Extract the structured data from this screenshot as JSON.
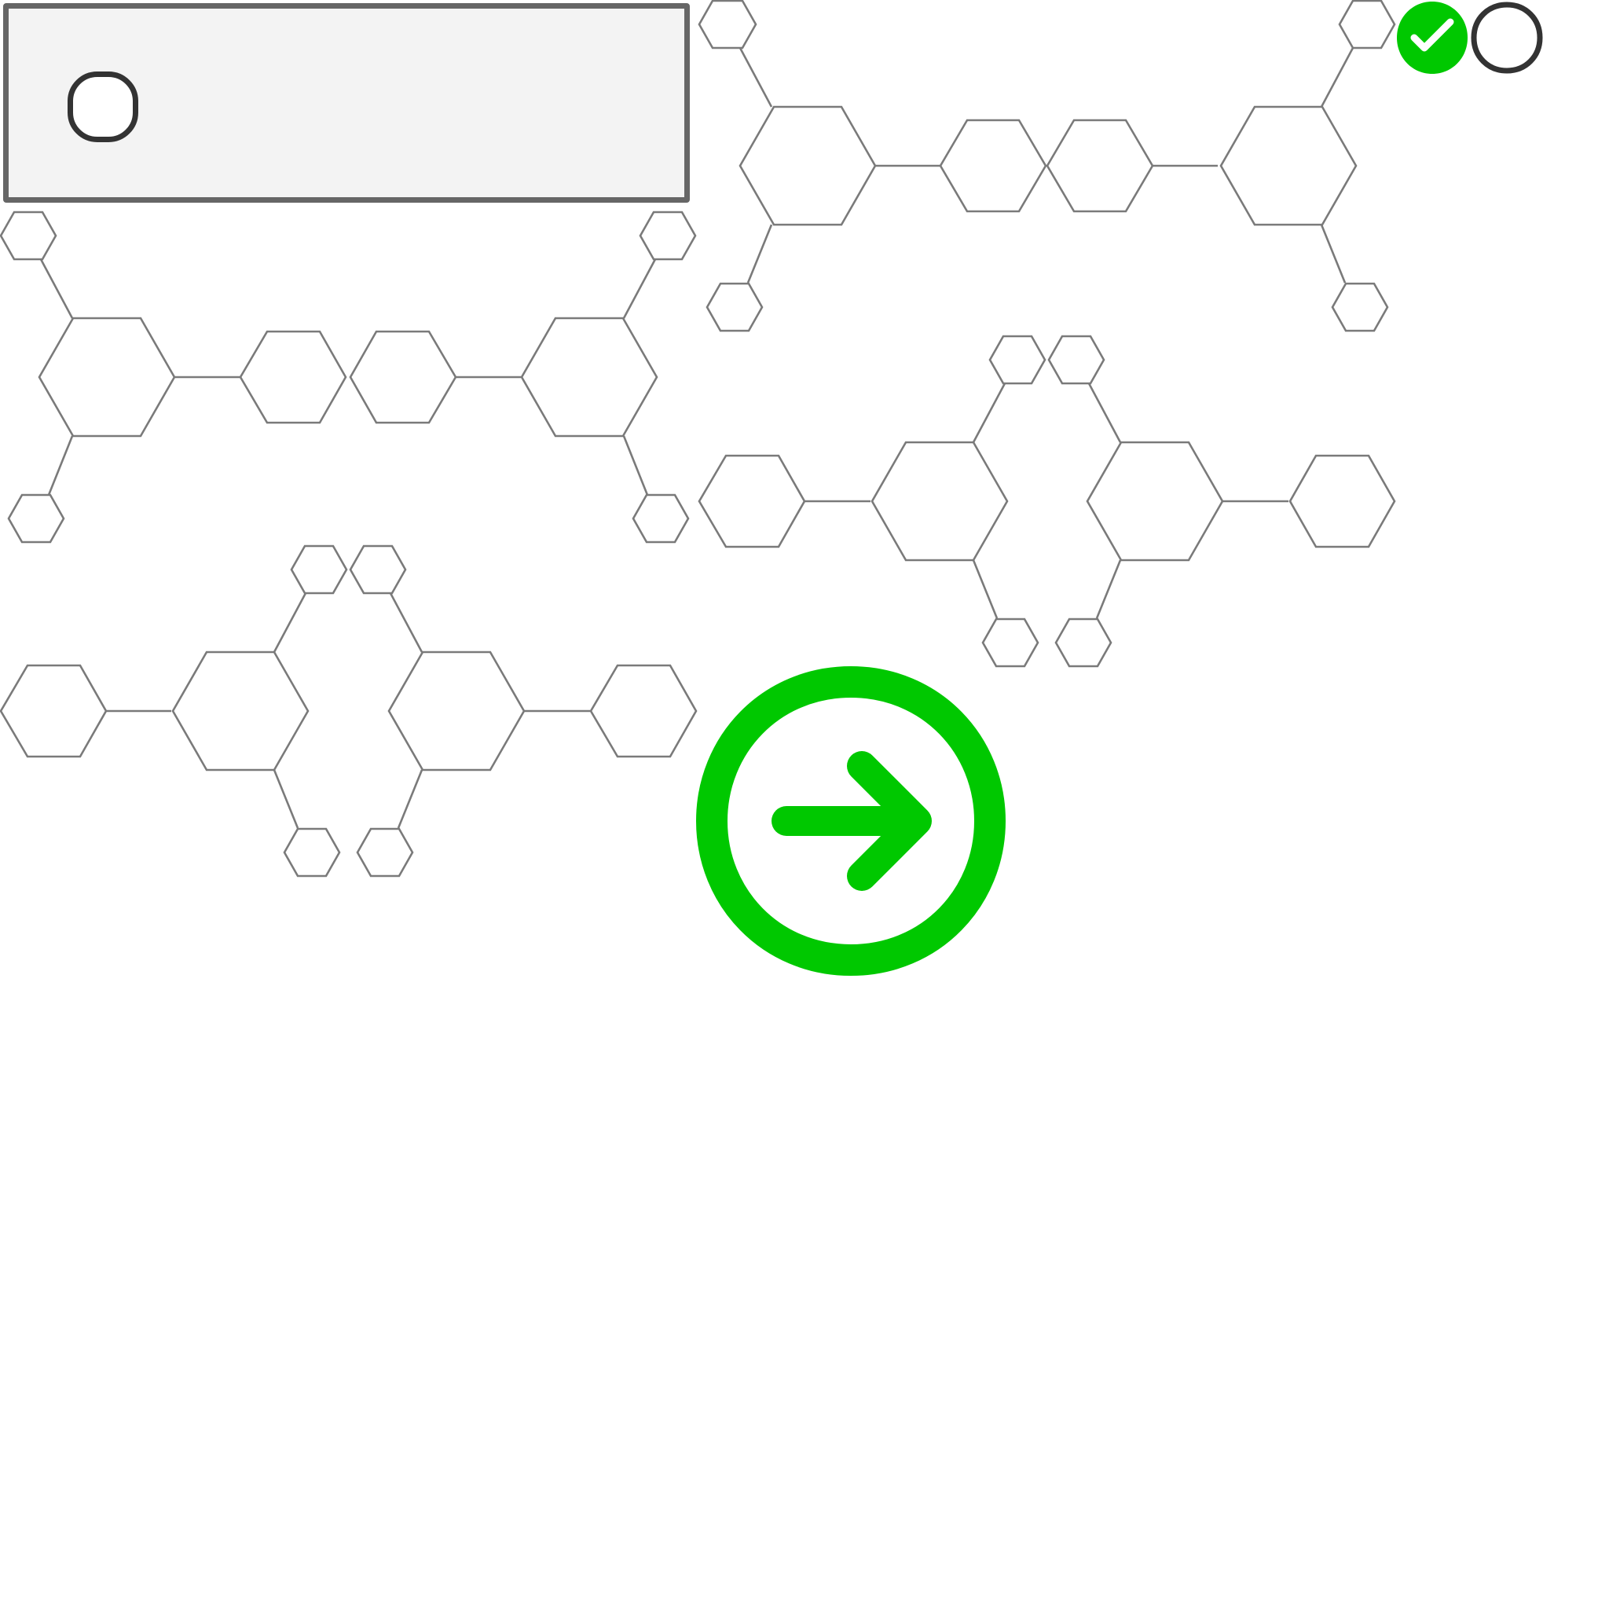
{
  "screen": {
    "kind": "molecule-matching question",
    "option": {
      "selected": false
    },
    "answer_status": {
      "correct_icon": "check-circle-icon",
      "pending_icon": "empty-circle-icon"
    },
    "navigation": {
      "next_icon": "arrow-right-circle-icon"
    },
    "colors": {
      "accent_green": "#00c800",
      "outline_dark": "#333333",
      "card_border": "#666666",
      "card_fill": "#f3f3f3",
      "molecule_stroke": "#7a7a7a"
    }
  }
}
